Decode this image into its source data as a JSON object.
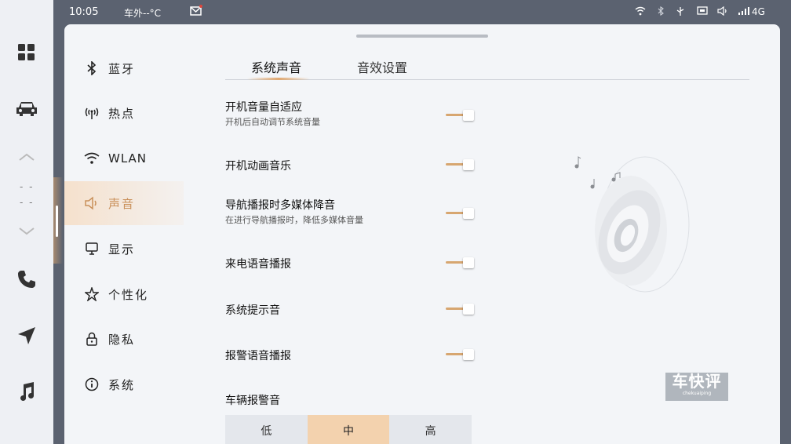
{
  "status_bar": {
    "time": "10:05",
    "outside_temp": "车外--°C",
    "network": "4G"
  },
  "dock": {
    "items": [
      {
        "icon": "apps-grid-icon"
      },
      {
        "icon": "car-icon"
      },
      {
        "icon": "chevron-up-icon"
      },
      {
        "icon": "phone-icon"
      },
      {
        "icon": "navigation-icon"
      },
      {
        "icon": "music-icon"
      }
    ],
    "temp_placeholder_top": "- -",
    "temp_placeholder_bottom": "- -"
  },
  "menu": {
    "items": [
      {
        "label": "蓝牙",
        "icon": "bluetooth-icon"
      },
      {
        "label": "热点",
        "icon": "hotspot-icon"
      },
      {
        "label": "WLAN",
        "icon": "wifi-icon"
      },
      {
        "label": "声音",
        "icon": "speaker-icon",
        "active": true
      },
      {
        "label": "显示",
        "icon": "monitor-icon"
      },
      {
        "label": "个性化",
        "icon": "personalize-icon"
      },
      {
        "label": "隐私",
        "icon": "lock-icon"
      },
      {
        "label": "系统",
        "icon": "info-icon"
      }
    ]
  },
  "tabs": [
    {
      "label": "系统声音",
      "active": true
    },
    {
      "label": "音效设置",
      "active": false
    }
  ],
  "settings": [
    {
      "title": "开机音量自适应",
      "subtitle": "开机后自动调节系统音量",
      "enabled": true
    },
    {
      "title": "开机动画音乐",
      "subtitle": "",
      "enabled": true
    },
    {
      "title": "导航播报时多媒体降音",
      "subtitle": "在进行导航播报时，降低多媒体音量",
      "enabled": true
    },
    {
      "title": "来电语音播报",
      "subtitle": "",
      "enabled": true
    },
    {
      "title": "系统提示音",
      "subtitle": "",
      "enabled": true
    },
    {
      "title": "报警语音播报",
      "subtitle": "",
      "enabled": true
    }
  ],
  "alarm_volume": {
    "title": "车辆报警音",
    "options": [
      "低",
      "中",
      "高"
    ],
    "selected": "中"
  },
  "watermark": {
    "title": "车快评",
    "sub": "chekuaiping"
  },
  "colors": {
    "accent": "#d7a670",
    "active_bg": "#f3d2ae"
  }
}
